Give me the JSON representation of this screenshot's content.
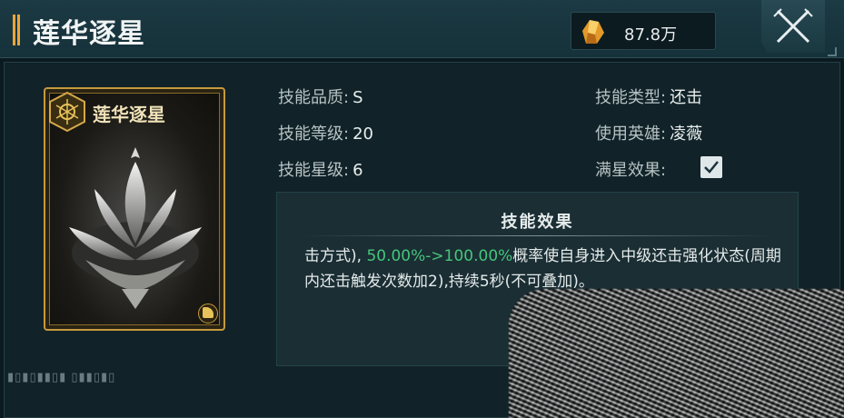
{
  "header": {
    "title": "莲华逐星",
    "currency_value": "87.8万",
    "currency_icon": "gold-crystal-icon",
    "close_icon": "crossed-swords-close-icon"
  },
  "card": {
    "name": "莲华逐星",
    "badge_icon": "hexagon-emblem-icon",
    "art": "silver-lotus-illustration",
    "corner_icon": "fist-icon"
  },
  "attributes": {
    "quality_label": "技能品质:",
    "quality_value": "S",
    "level_label": "技能等级:",
    "level_value": "20",
    "star_label": "技能星级:",
    "star_value": "6",
    "type_label": "技能类型:",
    "type_value": "还击",
    "hero_label": "使用英雄:",
    "hero_value": "凌薇",
    "max_star_label": "满星效果:",
    "max_star_checked": true
  },
  "effect": {
    "title": "技能效果",
    "text_before": "击方式),",
    "highlight": "50.00%->100.00%",
    "text_after": "概率使自身进入中级还击强化状态(周期内还击触发次数加2),持续5秒(不可叠加)。"
  },
  "footer": {
    "marks": "▮▯▮▯▮▮▯▮ ▯▮▮▯▮▯"
  },
  "colors": {
    "accent_gold": "#c59a3d",
    "highlight_green": "#45c67a",
    "panel_bg": "#112328"
  }
}
